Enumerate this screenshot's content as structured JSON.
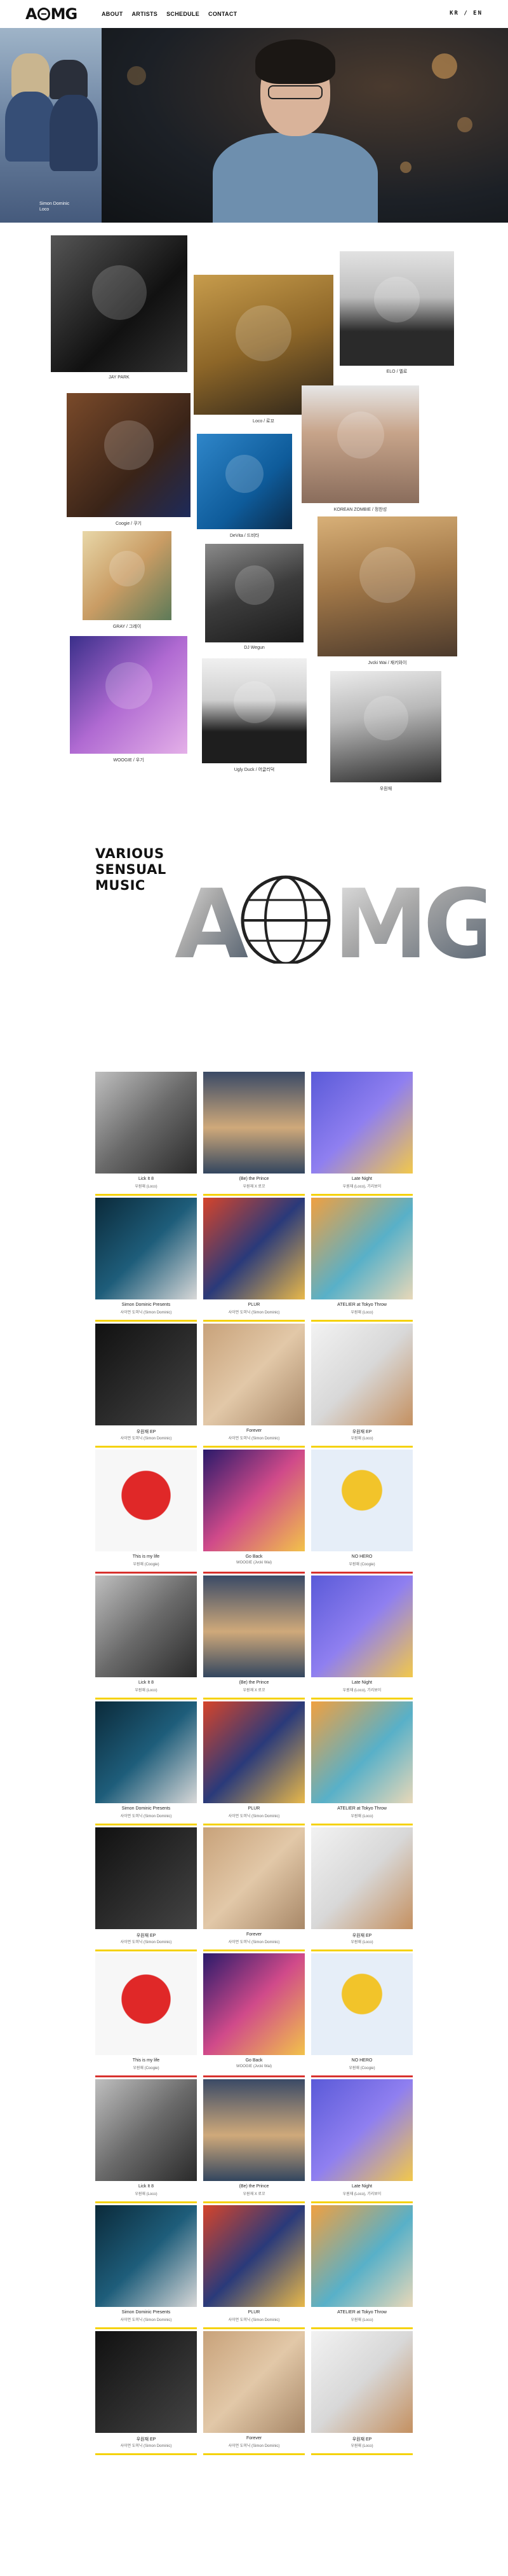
{
  "header": {
    "logo": "A MG",
    "nav": [
      "ABOUT",
      "ARTISTS",
      "SCHEDULE",
      "CONTACT"
    ],
    "lang_toggle": "KR / EN"
  },
  "hero": {
    "caption_line1": "Simon Dominic",
    "caption_line2": "Loco"
  },
  "artists": [
    {
      "name": "JAY PARK"
    },
    {
      "name": "ELO / 엘로"
    },
    {
      "name": "Loco / 로꼬"
    },
    {
      "name": "Coogie / 쿠기"
    },
    {
      "name": "DeVita / 드비타"
    },
    {
      "name": "KOREAN ZOMBIE / 정찬성"
    },
    {
      "name": "GRAY / 그레이"
    },
    {
      "name": "DJ Wegun"
    },
    {
      "name": "Jvcki Wai / 재키와이"
    },
    {
      "name": "WOOGIE / 우기"
    },
    {
      "name": "Ugly Duck / 어글리덕"
    },
    {
      "name": "우원재"
    }
  ],
  "slogan": [
    "VARIOUS",
    "SENSUAL",
    "MUSIC"
  ],
  "releases": [
    {
      "title": "Lick It 8",
      "artist": "우원재 (Loco)"
    },
    {
      "title": "(Be) the Prince",
      "artist": "우원재 X 로꼬"
    },
    {
      "title": "Late Night",
      "artist": "우원재 (Loco), 기리보이"
    },
    {
      "title": "Simon Dominic Presents",
      "artist": "사이먼 도미닉 (Simon Dominic)"
    },
    {
      "title": "PLUR",
      "artist": "사이먼 도미닉 (Simon Dominic)"
    },
    {
      "title": "ATELIER at Tokyo Throw",
      "artist": "우원재 (Loco)"
    },
    {
      "title": "우원재 EP",
      "artist": "사이먼 도미닉 (Simon Dominic)"
    },
    {
      "title": "Forever",
      "artist": "사이먼 도미닉 (Simon Dominic)"
    },
    {
      "title": "우원재 EP",
      "artist": "우원재 (Loco)"
    },
    {
      "title": "This is my life",
      "artist": "우원재 (Coogie)"
    },
    {
      "title": "Go Back",
      "artist": "WOOGIE (Jvcki Wai)"
    },
    {
      "title": "NO HERO",
      "artist": "우원재 (Coogie)"
    }
  ],
  "colors": {
    "accent_yellow": "#f5d20c",
    "accent_red": "#d8322e"
  }
}
